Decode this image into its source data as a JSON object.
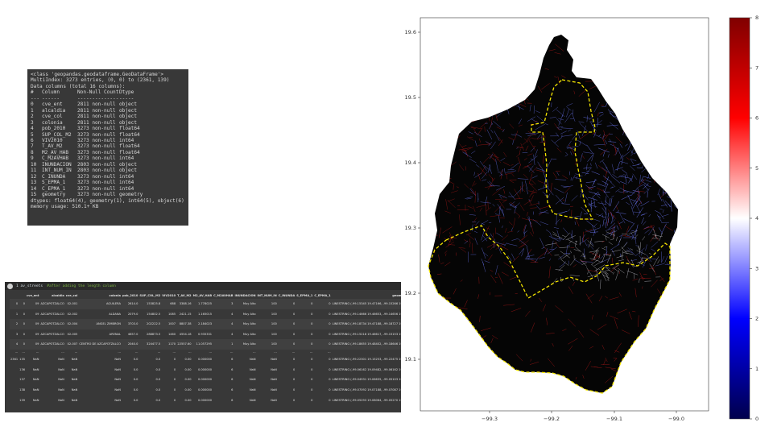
{
  "info": {
    "lines": [
      "<class 'geopandas.geodataframe.GeoDataFrame'>",
      "MultiIndex: 3273 entries, (0, 0) to (2361, 139)",
      "Data columns (total 16 columns):"
    ],
    "header": [
      "#",
      "Column",
      "Non-Null Count",
      "Dtype"
    ],
    "separator": [
      "---",
      "------",
      "--------------",
      "-----"
    ],
    "rows": [
      [
        "0",
        "cve_ent",
        "2811 non-null",
        "object"
      ],
      [
        "1",
        "alcaldia",
        "2811 non-null",
        "object"
      ],
      [
        "2",
        "cve_col",
        "2811 non-null",
        "object"
      ],
      [
        "3",
        "colonia",
        "2811 non-null",
        "object"
      ],
      [
        "4",
        "pob_2010",
        "3273 non-null",
        "float64"
      ],
      [
        "5",
        "SUP_COL_M2",
        "3273 non-null",
        "float64"
      ],
      [
        "6",
        "VIV2010",
        "3273 non-null",
        "int64"
      ],
      [
        "7",
        "T_AV_M2",
        "3273 non-null",
        "float64"
      ],
      [
        "8",
        "M2_AV_HAB",
        "3273 non-null",
        "float64"
      ],
      [
        "9",
        "C_M2AVHAB",
        "3273 non-null",
        "int64"
      ],
      [
        "10",
        "INUNDACION",
        "2803 non-null",
        "object"
      ],
      [
        "11",
        "INT_NUM_IN",
        "2803 non-null",
        "object"
      ],
      [
        "12",
        "C_INUNDA",
        "3273 non-null",
        "int64"
      ],
      [
        "13",
        "S_EPMA_1",
        "3273 non-null",
        "int64"
      ],
      [
        "14",
        "C_EPMA_1",
        "3273 non-null",
        "int64"
      ],
      [
        "15",
        "geometry",
        "3273 non-null",
        "geometry"
      ]
    ],
    "dtypes": "dtypes: float64(4), geometry(1), int64(5), object(6)",
    "memory": "memory usage: 510.1+ KB"
  },
  "df_cell": {
    "code": "1 av_streets",
    "comment": "#after adding the length column",
    "columns": [
      "",
      "",
      "cve_ent",
      "alcaldia",
      "cve_col",
      "colonia",
      "pob_2010",
      "SUP_COL_M2",
      "VIV2010",
      "T_AV_M2",
      "M2_AV_HAB",
      "C_M2AVHAB",
      "INUNDACION",
      "INT_NUM_IN",
      "C_INUNDA",
      "S_EPMA_1",
      "C_EPMA_1",
      "geometry",
      "length"
    ],
    "rows_top": [
      [
        "0",
        "0",
        "09",
        "AZCAPOTZALCO",
        "02-001",
        "AGUILERA",
        "2614.0",
        "153825.8",
        "688",
        "3388.16",
        "1.778025",
        "3",
        "Muy Alto",
        "100",
        "0",
        "0",
        "0",
        "LINESTRING (-99.15345 19.47166, -99.15266 19.4...",
        "0"
      ],
      [
        "1",
        "0",
        "09",
        "AZCAPOTZALCO",
        "02-002",
        "ALDANA",
        "2079.0",
        "154802.5",
        "1085",
        "2421.15",
        "1.165015",
        "4",
        "Muy Alto",
        "100",
        "0",
        "0",
        "0",
        "LINESTRING (-99.14666 19.46653, -99.14656 19.4...",
        "0"
      ],
      [
        "2",
        "0",
        "09",
        "AZCAPOTZALCO",
        "02-004",
        "ANGEL ZIMBRON",
        "3703.0",
        "202222.5",
        "1007",
        "8807.38",
        "2.184023",
        "4",
        "Muy Alto",
        "100",
        "0",
        "0",
        "0",
        "LINESTRING (-99.18734 19.47188, -99.18727 19.4...",
        "0"
      ],
      [
        "3",
        "0",
        "09",
        "AZCAPOTZALCO",
        "02-005",
        "ARENAL",
        "4657.0",
        "288873.5",
        "1460",
        "4554.18",
        "0.935331",
        "4",
        "Muy Alto",
        "100",
        "0",
        "0",
        "0",
        "LINESTRING (-99.15218 19.46617, -99.15153 19.4...",
        "0"
      ],
      [
        "4",
        "0",
        "09",
        "AZCAPOTZALCO",
        "02-007",
        "CENTRO DE AZCAPOTZALCO",
        "2040.0",
        "324477.5",
        "1170",
        "22557.60",
        "11.057295",
        "1",
        "Muy Alto",
        "100",
        "0",
        "0",
        "0",
        "LINESTRING (-99.18655 19.48402, -99.18646 19.4...",
        "0"
      ]
    ],
    "rows_bottom": [
      [
        "2361",
        "135",
        "NaN",
        "NaN",
        "NaN",
        "NaN",
        "0.0",
        "0.0",
        "0",
        "0.00",
        "0.000000",
        "6",
        "NaN",
        "NaN",
        "0",
        "0",
        "0",
        "LINESTRING (-99.22301 19.15253, -99.22475 19.1...",
        "1"
      ],
      [
        "",
        "136",
        "NaN",
        "NaN",
        "NaN",
        "NaN",
        "0.0",
        "0.0",
        "0",
        "0.00",
        "0.000000",
        "6",
        "NaN",
        "NaN",
        "0",
        "0",
        "0",
        "LINESTRING (-99.06162 19.09482, -99.06162 19.0...",
        "1"
      ],
      [
        "",
        "137",
        "NaN",
        "NaN",
        "NaN",
        "NaN",
        "0.0",
        "0.0",
        "0",
        "0.00",
        "0.000000",
        "6",
        "NaN",
        "NaN",
        "0",
        "0",
        "0",
        "LINESTRING (-99.04931 19.06635, -99.05103 19.0...",
        "1"
      ],
      [
        "",
        "138",
        "NaN",
        "NaN",
        "NaN",
        "NaN",
        "0.0",
        "0.0",
        "0",
        "0.00",
        "0.000000",
        "6",
        "NaN",
        "NaN",
        "0",
        "0",
        "0",
        "LINESTRING (-99.07092 19.07188, -99.07087 19.0...",
        "1"
      ],
      [
        "",
        "139",
        "NaN",
        "NaN",
        "NaN",
        "NaN",
        "0.0",
        "0.0",
        "0",
        "0.00",
        "0.000000",
        "6",
        "NaN",
        "NaN",
        "0",
        "0",
        "0",
        "LINESTRING (-99.05293 19.08064, -99.05270 19.0...",
        "1"
      ]
    ]
  },
  "map": {
    "x_ticks": [
      "−99.3",
      "−99.2",
      "−99.1",
      "−99.0"
    ],
    "y_ticks": [
      "19.6",
      "19.5",
      "19.4",
      "19.3",
      "19.2",
      "19.1"
    ],
    "colorbar_ticks": [
      "8",
      "7",
      "6",
      "5",
      "4",
      "3",
      "2",
      "1",
      "0"
    ],
    "colormap": "seismic",
    "colors": {
      "map_fill": "#050505",
      "outline": "#f5e600",
      "red_edges": "#c21a1a",
      "blue_edges": "#6f7bff"
    }
  }
}
